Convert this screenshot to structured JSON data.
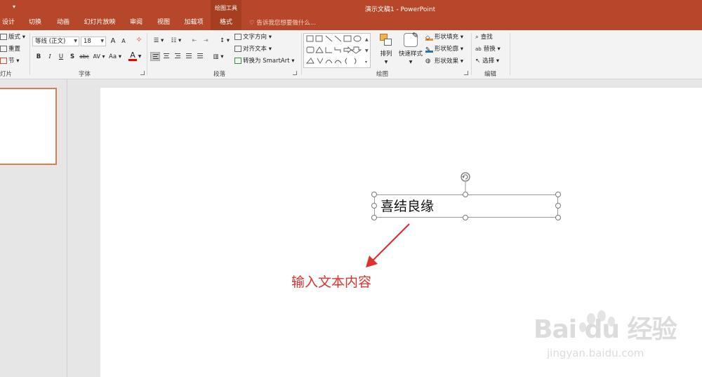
{
  "titlebar": {
    "quick_access": "▾",
    "context_group": "绘图工具",
    "document_title": "演示文稿1 - PowerPoint"
  },
  "tabs": [
    {
      "label": "设计"
    },
    {
      "label": "切换"
    },
    {
      "label": "动画"
    },
    {
      "label": "幻灯片放映"
    },
    {
      "label": "审阅"
    },
    {
      "label": "视图"
    },
    {
      "label": "加载项"
    },
    {
      "label": "格式"
    }
  ],
  "tell_me": "告诉我您想要做什么...",
  "ribbon": {
    "slides": {
      "layout": "版式",
      "reset": "重置",
      "section": "节",
      "label": "灯片"
    },
    "font": {
      "name": "等线 (正文)",
      "size": "18",
      "grow": "A",
      "shrink": "A",
      "bold": "B",
      "italic": "I",
      "underline": "U",
      "shadow": "S",
      "strike": "abc",
      "spacing": "AV",
      "case": "Aa",
      "color": "A",
      "label": "字体"
    },
    "paragraph": {
      "text_direction": "文字方向",
      "align_text": "对齐文本",
      "smartart": "转换为 SmartArt",
      "label": "段落"
    },
    "drawing": {
      "arrange": "排列",
      "quick_styles": "快速样式",
      "fill": "形状填充",
      "outline": "形状轮廓",
      "effects": "形状效果",
      "label": "绘图"
    },
    "editing": {
      "find": "查找",
      "replace": "替换",
      "select": "选择",
      "label": "编辑"
    }
  },
  "slide": {
    "textbox_text": "喜结良缘",
    "annotation": "输入文本内容"
  },
  "watermark": {
    "brand": "Bai du 经验",
    "url": "jingyan.baidu.com"
  },
  "colors": {
    "accent": "#b7472a",
    "annotation": "#e2302c",
    "thumb_border": "#e07a55"
  }
}
